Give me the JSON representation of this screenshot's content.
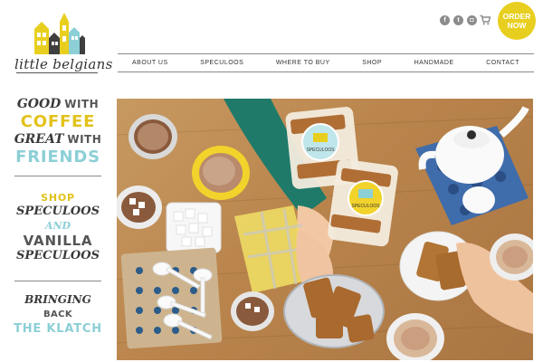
{
  "brand": {
    "name": "little belgians",
    "colors": {
      "yellow": "#e8cf1f",
      "blue": "#8ccfd6",
      "text": "#3d3d3d"
    }
  },
  "header": {
    "social_icons": [
      "facebook-icon",
      "twitter-icon",
      "instagram-icon"
    ],
    "cart_icon": "cart-icon",
    "order_button": {
      "line1": "ORDER",
      "line2": "NOW"
    }
  },
  "nav": {
    "items": [
      "ABOUT US",
      "SPECULOOS",
      "WHERE TO BUY",
      "SHOP",
      "HANDMADE",
      "CONTACT"
    ]
  },
  "tagline": {
    "block1": {
      "good": "GOOD",
      "with1": "WITH",
      "coffee": "COFFEE",
      "great": "GREAT",
      "with2": "WITH",
      "friends": "FRIENDS"
    },
    "block2": {
      "shop": "SHOP",
      "speculoos1": "SPECULOOS",
      "and": "AND",
      "vanilla": "VANILLA",
      "speculoos2": "SPECULOOS"
    },
    "block3": {
      "bringing": "BRINGING",
      "back": "BACK",
      "klatch": "THE KLATCH"
    }
  },
  "hero": {
    "package_label_1": "SPECULOOS",
    "package_label_2": "SPECULOOS"
  }
}
